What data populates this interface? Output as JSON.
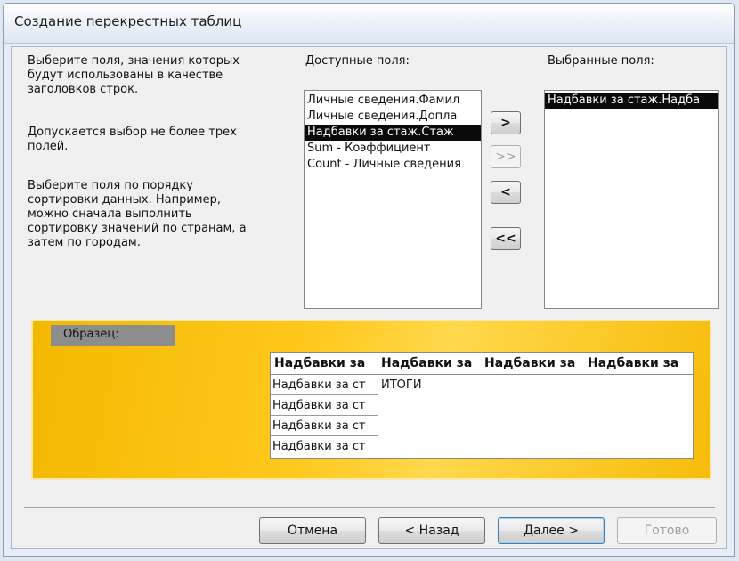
{
  "window": {
    "title": "Создание перекрестных таблиц"
  },
  "instructions": {
    "p1": [
      "Выберите поля, значения которых",
      "будут использованы в качестве",
      "заголовков строк."
    ],
    "p2": [
      "Допускается выбор не более трех",
      "полей."
    ],
    "p3": [
      "Выберите поля по порядку",
      "сортировки данных.  Например,",
      "можно сначала выполнить",
      "сортировку значений по странам, а",
      "затем по городам."
    ]
  },
  "available": {
    "label": "Доступные поля:",
    "items": [
      "Личные сведения.Фамил",
      "Личные сведения.Допла",
      "Надбавки за стаж.Стаж",
      "Sum - Коэффициент",
      "Count - Личные сведения"
    ],
    "selected_index": 2
  },
  "selected": {
    "label": "Выбранные поля:",
    "items": [
      "Надбавки за стаж.Надба"
    ]
  },
  "move_buttons": {
    "add": ">",
    "add_all": ">>",
    "remove": "<",
    "remove_all": "<<"
  },
  "sample": {
    "label": "Образец:",
    "headers": [
      "Надбавки за",
      "Надбавки за",
      "Надбавки за",
      "Надбавки за"
    ],
    "rows": [
      "Надбавки за ст",
      "Надбавки за ст",
      "Надбавки за ст",
      "Надбавки за ст"
    ],
    "totals": "ИТОГИ"
  },
  "footer": {
    "cancel": "Отмена",
    "back": "< Назад",
    "next": "Далее >",
    "finish": "Готово"
  }
}
